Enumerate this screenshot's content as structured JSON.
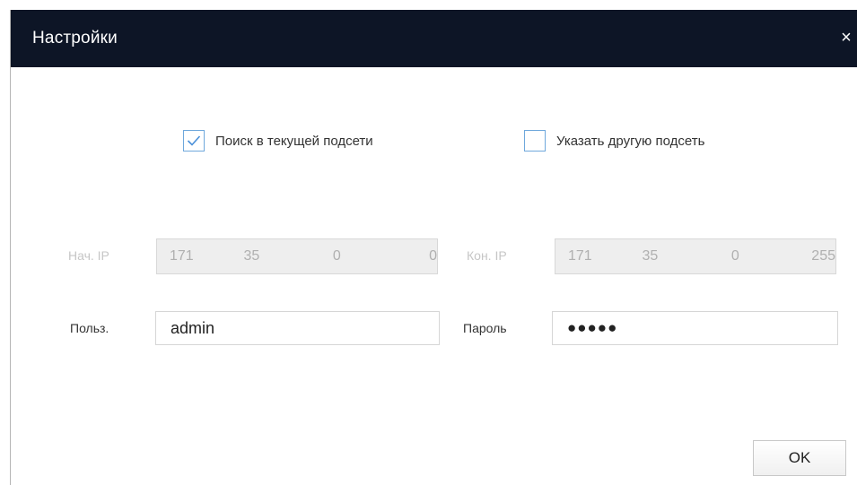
{
  "dialog": {
    "title": "Настройки",
    "close_glyph": "×"
  },
  "options": {
    "current_subnet": {
      "label": "Поиск в текущей подсети",
      "checked": true
    },
    "other_subnet": {
      "label": "Указать другую подсеть",
      "checked": false
    }
  },
  "range": {
    "start_label": "Нач. IP",
    "start_ip": [
      "171",
      "35",
      "0",
      "0"
    ],
    "end_label": "Кон. IP",
    "end_ip": [
      "171",
      "35",
      "0",
      "255"
    ],
    "disabled": true
  },
  "credentials": {
    "user_label": "Польз.",
    "user_value": "admin",
    "password_label": "Пароль",
    "password_mask": "●●●●●"
  },
  "buttons": {
    "ok_label": "OK"
  },
  "colors": {
    "titlebar": "#0d1526",
    "checkbox_border": "#6fa8dc",
    "checkmark": "#4a90d9"
  }
}
